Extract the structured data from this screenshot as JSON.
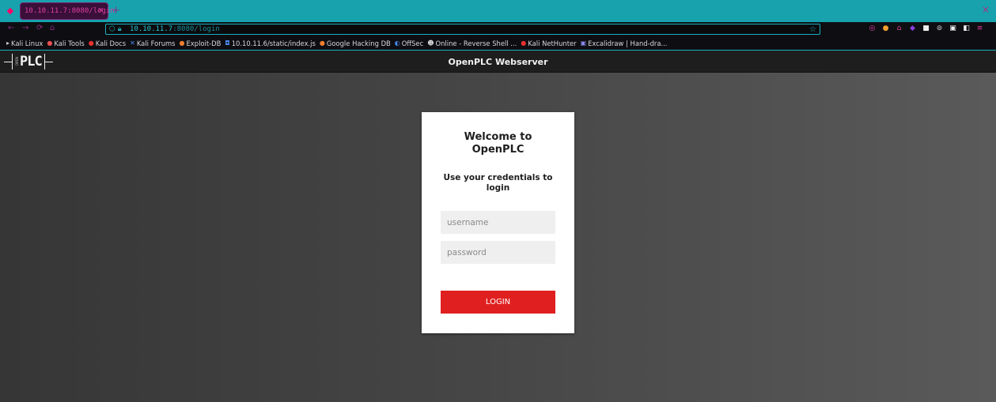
{
  "browser": {
    "tab": {
      "title": "10.10.11.7:8080/login",
      "close": "×"
    },
    "new_tab": "+",
    "window_close": "×",
    "nav": {
      "back": "←",
      "forward": "→",
      "reload": "⟳",
      "home": "⌂"
    },
    "url": {
      "host": "10.10.11.7",
      "path": ":8080/login",
      "icons": "⬡ 🔒︎",
      "star": "☆"
    },
    "extensions": [
      "◎",
      "●",
      "⌂",
      "◆",
      "■",
      "⊚",
      "▣",
      "◧",
      "≡"
    ],
    "colors": {
      "accent": "#1ab0bf",
      "tab_text": "#e040a0"
    }
  },
  "bookmarks": [
    {
      "label": "Kali Linux",
      "icon": "▸",
      "color": "#ccc"
    },
    {
      "label": "Kali Tools",
      "icon": "●",
      "color": "#e85050"
    },
    {
      "label": "Kali Docs",
      "icon": "●",
      "color": "#e83030"
    },
    {
      "label": "Kali Forums",
      "icon": "✕",
      "color": "#4a8af0"
    },
    {
      "label": "Exploit-DB",
      "icon": "●",
      "color": "#f08030"
    },
    {
      "label": "10.10.11.6/static/index.js",
      "icon": "◘",
      "color": "#4a8af0"
    },
    {
      "label": "Google Hacking DB",
      "icon": "●",
      "color": "#f08030"
    },
    {
      "label": "OffSec",
      "icon": "◐",
      "color": "#4a8af0"
    },
    {
      "label": "Online - Reverse Shell ...",
      "icon": "☻",
      "color": "#ddd"
    },
    {
      "label": "Kali NetHunter",
      "icon": "●",
      "color": "#e83030"
    },
    {
      "label": "Excalidraw | Hand-dra...",
      "icon": "▣",
      "color": "#8a8af0"
    }
  ],
  "header": {
    "logo_small": "OPEN",
    "logo_text": "PLC",
    "title": "OpenPLC Webserver"
  },
  "login": {
    "welcome_line1": "Welcome to",
    "welcome_line2": "OpenPLC",
    "subtitle_line1": "Use your credentials to",
    "subtitle_line2": "login",
    "username_placeholder": "username",
    "password_placeholder": "password",
    "button_label": "LOGIN",
    "button_color": "#e02020"
  }
}
